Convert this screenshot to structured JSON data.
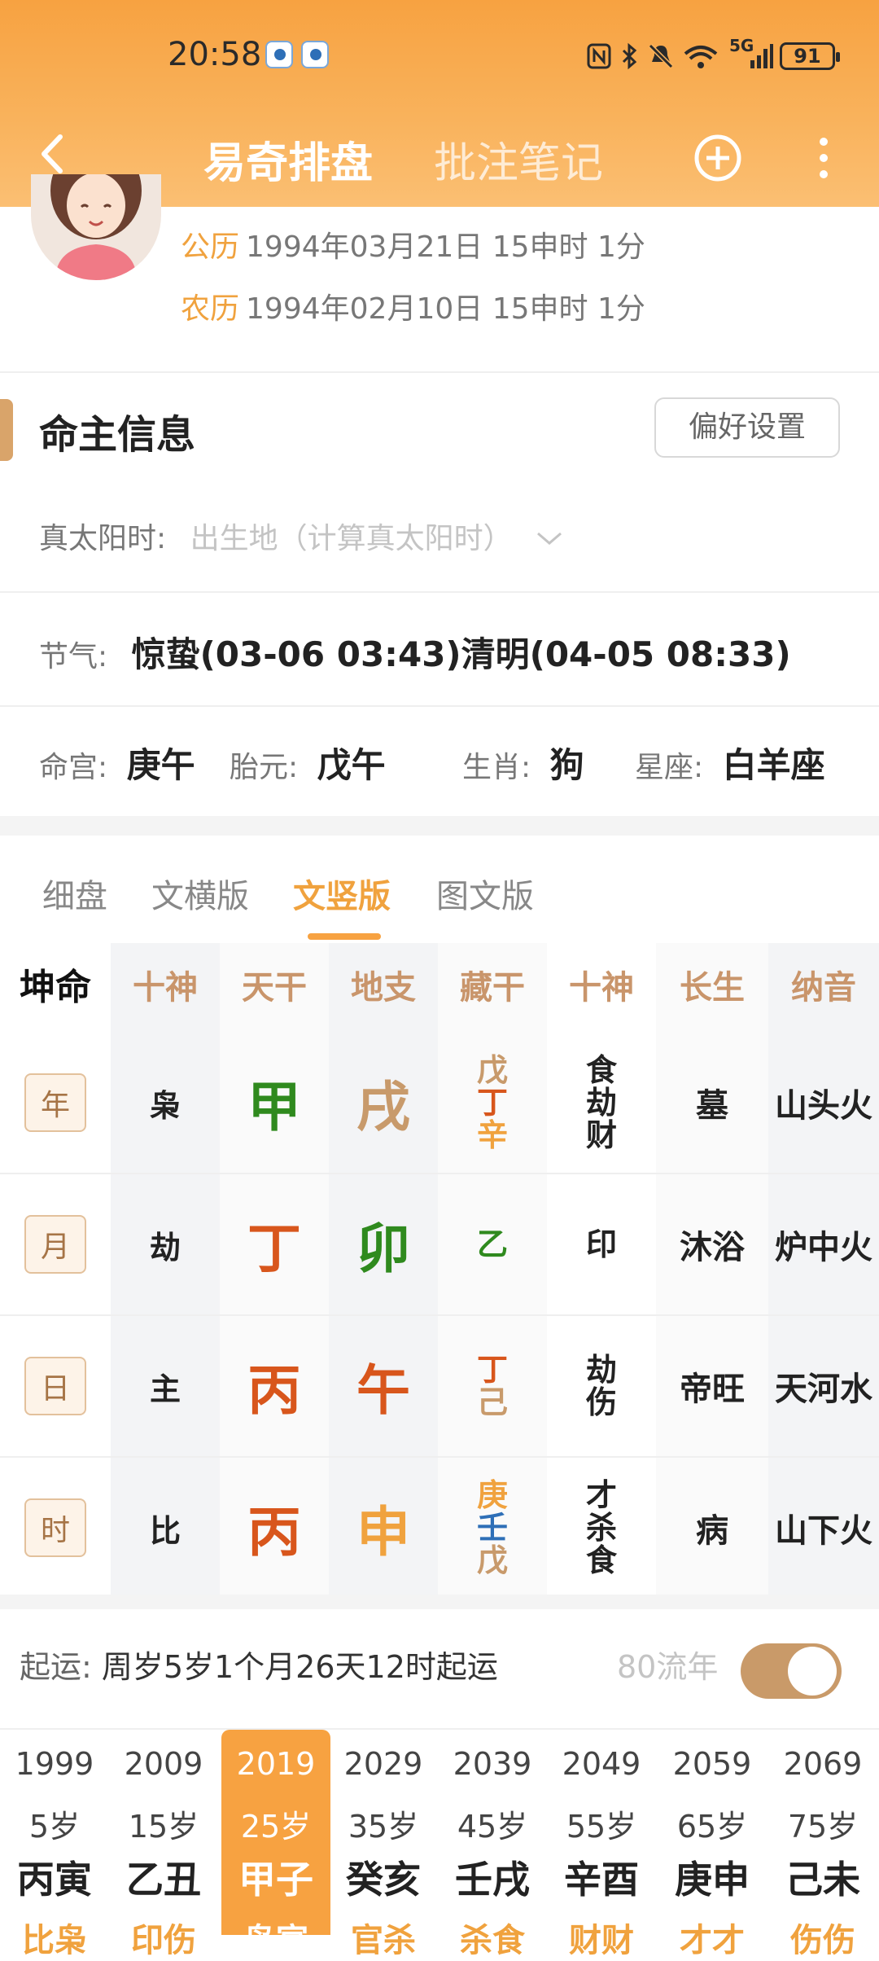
{
  "status_bar": {
    "time": "20:58",
    "network": "5G",
    "battery": "91"
  },
  "nav": {
    "title": "易奇排盘",
    "title2": "批注笔记"
  },
  "profile": {
    "solar_label": "公历",
    "solar_value": "1994年03月21日 15申时 1分",
    "lunar_label": "农历",
    "lunar_value": "1994年02月10日 15申时 1分"
  },
  "section": {
    "title": "命主信息",
    "pref_button": "偏好设置"
  },
  "info": {
    "solar_time_label": "真太阳时:",
    "solar_time_placeholder": "出生地（计算真太阳时）",
    "jieqi_label": "节气:",
    "jieqi_value": "惊蛰(03-06 03:43)清明(04-05 08:33)",
    "minggong_label": "命宫:",
    "minggong_value": "庚午",
    "taiyuan_label": "胎元:",
    "taiyuan_value": "戊午",
    "shengxiao_label": "生肖:",
    "shengxiao_value": "狗",
    "xingzuo_label": "星座:",
    "xingzuo_value": "白羊座"
  },
  "tabs": [
    "细盘",
    "文横版",
    "文竖版",
    "图文版"
  ],
  "grid": {
    "corner": "坤命",
    "headers": [
      "十神",
      "天干",
      "地支",
      "藏干",
      "十神",
      "长生",
      "纳音"
    ],
    "rows": [
      {
        "label": "年",
        "shen": "枭",
        "gan": "甲",
        "zhi": "戌",
        "canggan": [
          "戊",
          "丁",
          "辛"
        ],
        "shishen": [
          "食",
          "劫",
          "财"
        ],
        "changsheng": "墓",
        "nayin": "山头火"
      },
      {
        "label": "月",
        "shen": "劫",
        "gan": "丁",
        "zhi": "卯",
        "canggan": [
          "乙"
        ],
        "shishen": [
          "印"
        ],
        "changsheng": "沐浴",
        "nayin": "炉中火"
      },
      {
        "label": "日",
        "shen": "主",
        "gan": "丙",
        "zhi": "午",
        "canggan": [
          "丁",
          "己"
        ],
        "shishen": [
          "劫",
          "伤"
        ],
        "changsheng": "帝旺",
        "nayin": "天河水"
      },
      {
        "label": "时",
        "shen": "比",
        "gan": "丙",
        "zhi": "申",
        "canggan": [
          "庚",
          "壬",
          "戊"
        ],
        "shishen": [
          "才",
          "杀",
          "食"
        ],
        "changsheng": "病",
        "nayin": "山下火"
      }
    ],
    "colors": {
      "wood": "#2f8a1e",
      "fire": "#d8561c",
      "earth": "#c89a6b",
      "metal": "#f0a23e",
      "water": "#2e6fb7"
    }
  },
  "qiyun": {
    "label": "起运:",
    "value": "周岁5岁1个月26天12时起运",
    "liunian": "80流年"
  },
  "dayun": [
    {
      "year": "1999",
      "age": "5岁",
      "ganzhi": "丙寅",
      "sub": "比枭"
    },
    {
      "year": "2009",
      "age": "15岁",
      "ganzhi": "乙丑",
      "sub": "印伤"
    },
    {
      "year": "2019",
      "age": "25岁",
      "ganzhi": "甲子",
      "sub": "枭官"
    },
    {
      "year": "2029",
      "age": "35岁",
      "ganzhi": "癸亥",
      "sub": "官杀"
    },
    {
      "year": "2039",
      "age": "45岁",
      "ganzhi": "壬戌",
      "sub": "杀食"
    },
    {
      "year": "2049",
      "age": "55岁",
      "ganzhi": "辛酉",
      "sub": "财财"
    },
    {
      "year": "2059",
      "age": "65岁",
      "ganzhi": "庚申",
      "sub": "才才"
    },
    {
      "year": "2069",
      "age": "75岁",
      "ganzhi": "己未",
      "sub": "伤伤"
    }
  ]
}
